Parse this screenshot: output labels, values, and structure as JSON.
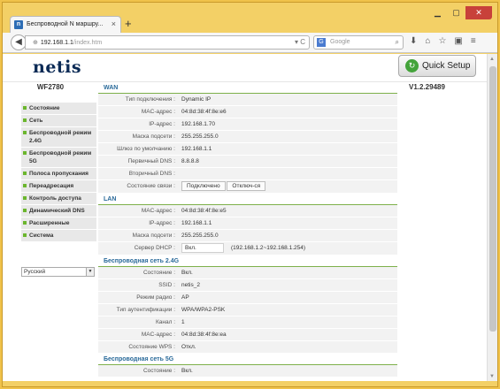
{
  "browser": {
    "tab_title": "Беспроводной N маршру...",
    "tab_favicon": "n",
    "url_host": "192.168.1.1",
    "url_path": "/index.htm",
    "search_placeholder": "Google",
    "search_engine_icon": "G",
    "new_tab": "+",
    "close_tab": "×"
  },
  "header": {
    "logo": "netis",
    "quick_setup": "Quick Setup"
  },
  "sidebar": {
    "model": "WF2780",
    "items": [
      {
        "label": "Состояние"
      },
      {
        "label": "Сеть"
      },
      {
        "label": "Беспроводной режим 2.4G"
      },
      {
        "label": "Беспроводной режим 5G"
      },
      {
        "label": "Полоса пропускания"
      },
      {
        "label": "Переадресация"
      },
      {
        "label": "Контроль доступа"
      },
      {
        "label": "Динамический DNS"
      },
      {
        "label": "Расширенные"
      },
      {
        "label": "Система"
      }
    ],
    "language": "Русский"
  },
  "version": "V1.2.29489",
  "sections": {
    "wan": {
      "title": "WAN",
      "conn_type_label": "Тип подключения :",
      "conn_type": "Dynamic IP",
      "mac_label": "MAC-адрес :",
      "mac": "04:8d:38:4f:8e:e6",
      "ip_label": "IP-адрес :",
      "ip": "192.168.1.70",
      "mask_label": "Маска подсети :",
      "mask": "255.255.255.0",
      "gw_label": "Шлюз по умолчанию :",
      "gw": "192.168.1.1",
      "dns1_label": "Первичный DNS :",
      "dns1": "8.8.8.8",
      "dns2_label": "Вторичный DNS :",
      "dns2": "",
      "status_label": "Состояние связи :",
      "status": "Подключено",
      "disconnect": "Отключ-ся"
    },
    "lan": {
      "title": "LAN",
      "mac_label": "MAC-адрес :",
      "mac": "04:8d:38:4f:8e:e5",
      "ip_label": "IP-адрес :",
      "ip": "192.168.1.1",
      "mask_label": "Маска подсети :",
      "mask": "255.255.255.0",
      "dhcp_label": "Сервер DHCP :",
      "dhcp": "Вкл.",
      "dhcp_range": "(192.168.1.2~192.168.1.254)"
    },
    "wifi24": {
      "title": "Беспроводная сеть 2.4G",
      "state_label": "Состояние :",
      "state": "Вкл.",
      "ssid_label": "SSID :",
      "ssid": "netis_2",
      "mode_label": "Режим радио :",
      "mode": "AP",
      "auth_label": "Тип аутентификации :",
      "auth": "WPA/WPA2-PSK",
      "channel_label": "Канал :",
      "channel": "1",
      "mac_label": "MAC-адрес :",
      "mac": "04:8d:38:4f:8e:ea",
      "wps_label": "Состояние WPS :",
      "wps": "Откл."
    },
    "wifi5": {
      "title": "Беспроводная сеть 5G",
      "state_label": "Состояние :",
      "state": "Вкл."
    }
  }
}
